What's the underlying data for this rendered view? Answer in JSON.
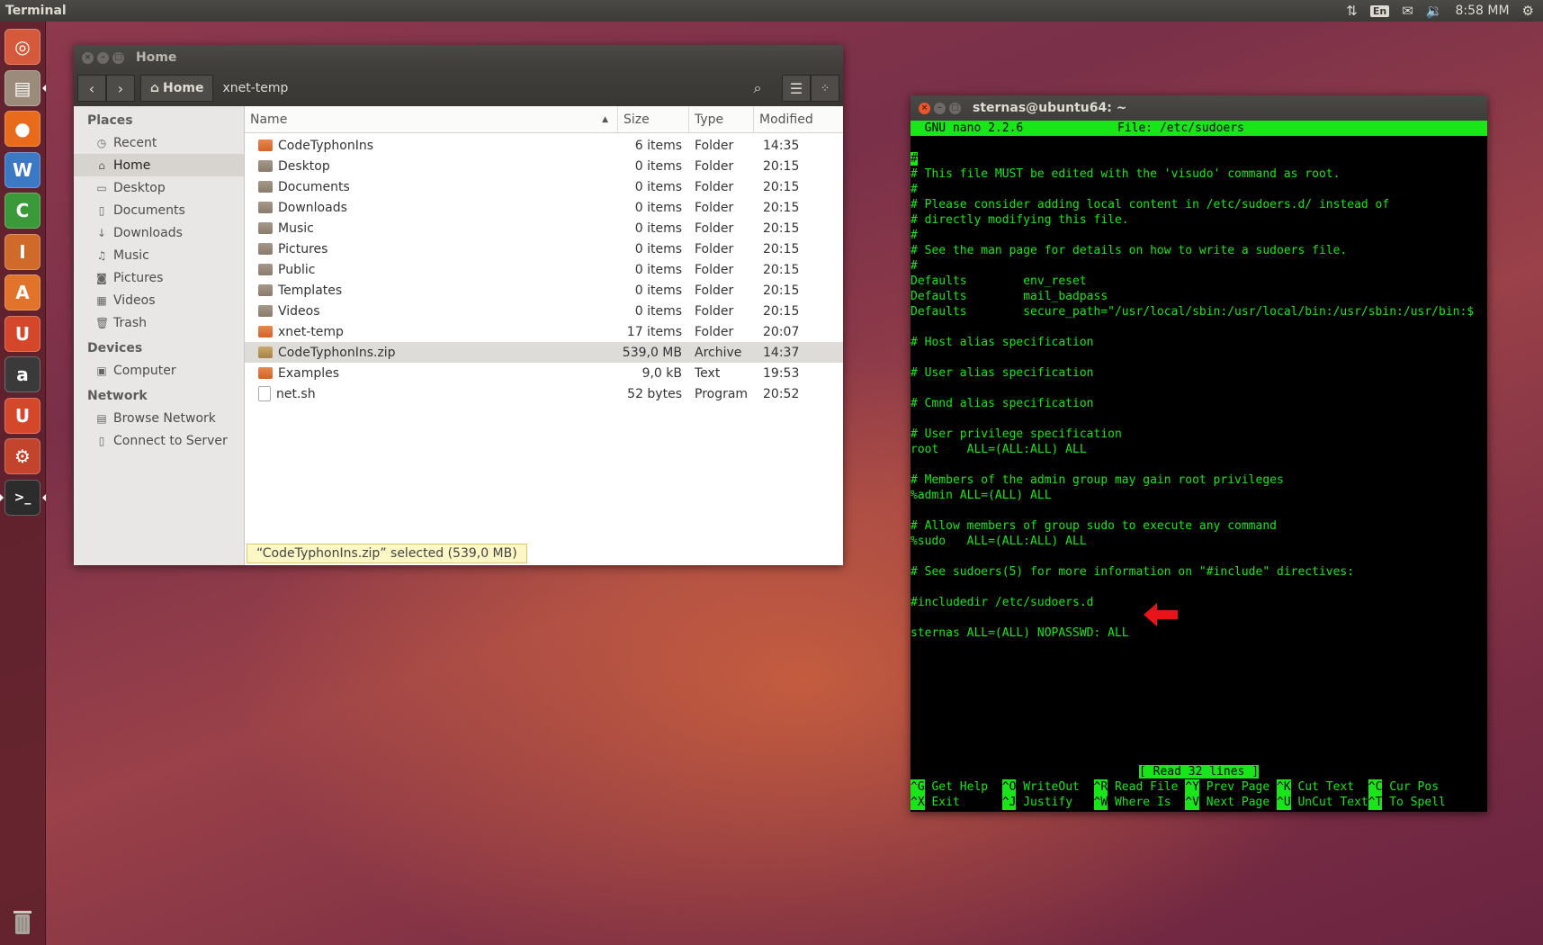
{
  "top_panel": {
    "app_name": "Terminal",
    "keyboard_layout": "En",
    "clock": "8:58 MM"
  },
  "launcher": {
    "items": [
      {
        "name": "dash-home",
        "glyph": "◎",
        "color": "#d45a3b"
      },
      {
        "name": "files",
        "glyph": "▤",
        "color": "#9a8b7a"
      },
      {
        "name": "firefox",
        "glyph": "●",
        "color": "#e86a1b"
      },
      {
        "name": "libreoffice-writer",
        "glyph": "W",
        "color": "#3c79c5"
      },
      {
        "name": "libreoffice-calc",
        "glyph": "C",
        "color": "#3a9a3a"
      },
      {
        "name": "libreoffice-impress",
        "glyph": "I",
        "color": "#d06a2a"
      },
      {
        "name": "ubuntu-software-center",
        "glyph": "A",
        "color": "#e1742a"
      },
      {
        "name": "ubuntu-one",
        "glyph": "U",
        "color": "#d4472a"
      },
      {
        "name": "amazon",
        "glyph": "a",
        "color": "#3a3a3a"
      },
      {
        "name": "ubuntu-one-music",
        "glyph": "U",
        "color": "#d4472a"
      },
      {
        "name": "system-settings",
        "glyph": "⚙",
        "color": "#c2442c"
      },
      {
        "name": "terminal",
        "glyph": ">_",
        "color": "#2c2c2c"
      }
    ]
  },
  "nautilus": {
    "title": "Home",
    "breadcrumbs": [
      "Home",
      "xnet-temp"
    ],
    "sidebar": {
      "places_heading": "Places",
      "places": [
        {
          "label": "Recent",
          "icon": "clock-icon",
          "glyph": "◷"
        },
        {
          "label": "Home",
          "icon": "home-icon",
          "glyph": "⌂"
        },
        {
          "label": "Desktop",
          "icon": "desktop-icon",
          "glyph": "▭"
        },
        {
          "label": "Documents",
          "icon": "document-icon",
          "glyph": "▯"
        },
        {
          "label": "Downloads",
          "icon": "download-icon",
          "glyph": "↓"
        },
        {
          "label": "Music",
          "icon": "music-icon",
          "glyph": "♫"
        },
        {
          "label": "Pictures",
          "icon": "camera-icon",
          "glyph": "◙"
        },
        {
          "label": "Videos",
          "icon": "film-icon",
          "glyph": "▦"
        },
        {
          "label": "Trash",
          "icon": "trash-icon",
          "glyph": "🗑"
        }
      ],
      "devices_heading": "Devices",
      "devices": [
        {
          "label": "Computer",
          "icon": "computer-icon",
          "glyph": "▣"
        }
      ],
      "network_heading": "Network",
      "network": [
        {
          "label": "Browse Network",
          "icon": "network-icon",
          "glyph": "▤"
        },
        {
          "label": "Connect to Server",
          "icon": "server-icon",
          "glyph": "▯"
        }
      ]
    },
    "columns": {
      "name": "Name",
      "size": "Size",
      "type": "Type",
      "modified": "Modified"
    },
    "files": [
      {
        "name": "CodeTyphonIns",
        "size": "6 items",
        "type": "Folder",
        "modified": "14:35",
        "icon": "folder"
      },
      {
        "name": "Desktop",
        "size": "0 items",
        "type": "Folder",
        "modified": "20:15",
        "icon": "folder special"
      },
      {
        "name": "Documents",
        "size": "0 items",
        "type": "Folder",
        "modified": "20:15",
        "icon": "folder special"
      },
      {
        "name": "Downloads",
        "size": "0 items",
        "type": "Folder",
        "modified": "20:15",
        "icon": "folder special"
      },
      {
        "name": "Music",
        "size": "0 items",
        "type": "Folder",
        "modified": "20:15",
        "icon": "folder special"
      },
      {
        "name": "Pictures",
        "size": "0 items",
        "type": "Folder",
        "modified": "20:15",
        "icon": "folder special"
      },
      {
        "name": "Public",
        "size": "0 items",
        "type": "Folder",
        "modified": "20:15",
        "icon": "folder special"
      },
      {
        "name": "Templates",
        "size": "0 items",
        "type": "Folder",
        "modified": "20:15",
        "icon": "folder special"
      },
      {
        "name": "Videos",
        "size": "0 items",
        "type": "Folder",
        "modified": "20:15",
        "icon": "folder special"
      },
      {
        "name": "xnet-temp",
        "size": "17 items",
        "type": "Folder",
        "modified": "20:07",
        "icon": "folder"
      },
      {
        "name": "CodeTyphonIns.zip",
        "size": "539,0 MB",
        "type": "Archive",
        "modified": "14:37",
        "icon": "zipico"
      },
      {
        "name": "Examples",
        "size": "9,0 kB",
        "type": "Text",
        "modified": "19:53",
        "icon": "folder"
      },
      {
        "name": "net.sh",
        "size": "52 bytes",
        "type": "Program",
        "modified": "20:52",
        "icon": "textico"
      }
    ],
    "status": "“CodeTyphonIns.zip” selected  (539,0 MB)"
  },
  "terminal": {
    "title": "sternas@ubuntu64: ~",
    "nano_version": "  GNU nano 2.2.6",
    "nano_file": "File: /etc/sudoers",
    "lines": [
      "#",
      "# This file MUST be edited with the 'visudo' command as root.",
      "#",
      "# Please consider adding local content in /etc/sudoers.d/ instead of",
      "# directly modifying this file.",
      "#",
      "# See the man page for details on how to write a sudoers file.",
      "#",
      "Defaults        env_reset",
      "Defaults        mail_badpass",
      "Defaults        secure_path=\"/usr/local/sbin:/usr/local/bin:/usr/sbin:/usr/bin:$",
      "",
      "# Host alias specification",
      "",
      "# User alias specification",
      "",
      "# Cmnd alias specification",
      "",
      "# User privilege specification",
      "root    ALL=(ALL:ALL) ALL",
      "",
      "# Members of the admin group may gain root privileges",
      "%admin ALL=(ALL) ALL",
      "",
      "# Allow members of group sudo to execute any command",
      "%sudo   ALL=(ALL:ALL) ALL",
      "",
      "# See sudoers(5) for more information on \"#include\" directives:",
      "",
      "#includedir /etc/sudoers.d",
      "",
      "sternas ALL=(ALL) NOPASSWD: ALL"
    ],
    "message": "[ Read 32 lines ]",
    "shortcuts_row1": [
      {
        "key": "^G",
        "label": "Get Help"
      },
      {
        "key": "^O",
        "label": "WriteOut"
      },
      {
        "key": "^R",
        "label": "Read File"
      },
      {
        "key": "^Y",
        "label": "Prev Page"
      },
      {
        "key": "^K",
        "label": "Cut Text"
      },
      {
        "key": "^C",
        "label": "Cur Pos"
      }
    ],
    "shortcuts_row2": [
      {
        "key": "^X",
        "label": "Exit"
      },
      {
        "key": "^J",
        "label": "Justify"
      },
      {
        "key": "^W",
        "label": "Where Is"
      },
      {
        "key": "^V",
        "label": "Next Page"
      },
      {
        "key": "^U",
        "label": "UnCut Text"
      },
      {
        "key": "^T",
        "label": "To Spell"
      }
    ],
    "annotation_color": "#e8141a"
  }
}
